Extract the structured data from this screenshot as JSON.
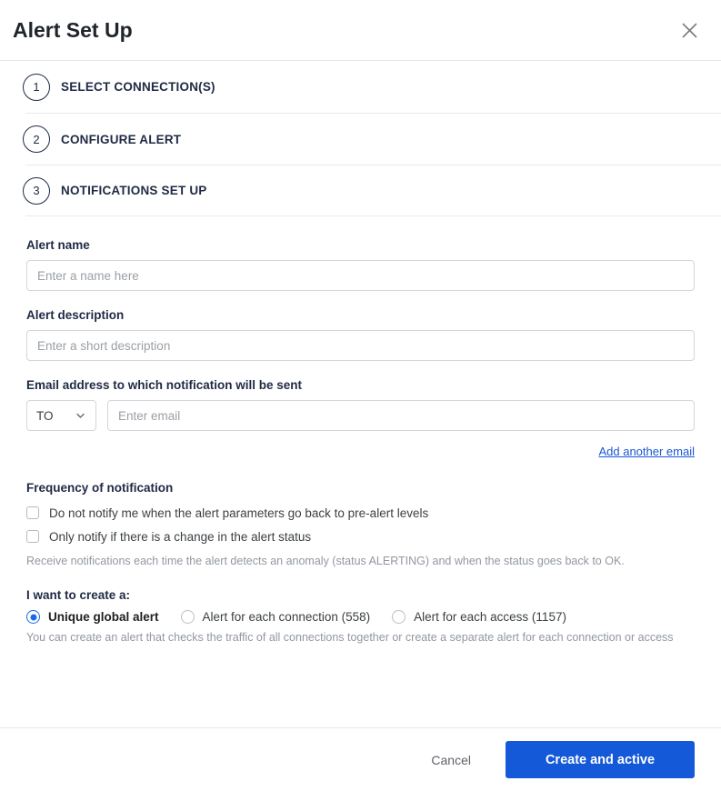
{
  "header": {
    "title": "Alert Set Up",
    "close_icon": "close-icon"
  },
  "steps": [
    {
      "number": "1",
      "label": "SELECT CONNECTION(S)"
    },
    {
      "number": "2",
      "label": "CONFIGURE ALERT"
    },
    {
      "number": "3",
      "label": "NOTIFICATIONS SET UP"
    }
  ],
  "form": {
    "alert_name": {
      "label": "Alert name",
      "placeholder": "Enter a name here",
      "value": ""
    },
    "alert_description": {
      "label": "Alert description",
      "placeholder": "Enter a short description",
      "value": ""
    },
    "email": {
      "label": "Email address to which notification will be sent",
      "recipient_type": "TO",
      "placeholder": "Enter email",
      "value": "",
      "add_another_link": "Add another email"
    }
  },
  "frequency": {
    "title": "Frequency of notification",
    "options": [
      {
        "label": "Do not notify me when the alert parameters go back to pre-alert levels",
        "checked": false
      },
      {
        "label": "Only notify if there is a change in the alert status",
        "checked": false
      }
    ],
    "helper": "Receive notifications each time the alert detects an anomaly (status ALERTING) and when the status goes back to OK."
  },
  "scope": {
    "title": "I want to create a:",
    "options": [
      {
        "label": "Unique global alert",
        "selected": true
      },
      {
        "label": "Alert for each connection (558)",
        "selected": false
      },
      {
        "label": "Alert for each access (1157)",
        "selected": false
      }
    ],
    "helper": "You can create an alert that checks the traffic of all connections together or create a separate alert for each connection or access"
  },
  "footer": {
    "cancel_label": "Cancel",
    "submit_label": "Create and active"
  },
  "colors": {
    "accent_blue": "#1459d8",
    "radio_blue": "#1a6ae8",
    "link_blue": "#1a56d6",
    "navy": "#1f2a44",
    "muted": "#9298a0"
  }
}
